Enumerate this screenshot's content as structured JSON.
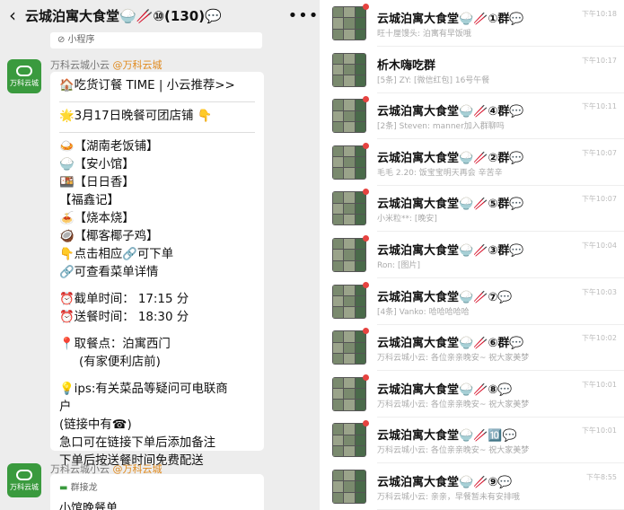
{
  "chat": {
    "back_icon": "back-arrow-icon",
    "title": "云城泊寓大食堂🍚🥢⑩(130)💬",
    "more": "•••",
    "mini_program": "⊘ 小程序",
    "sender1": "万科云城小云",
    "sender1_tag": "@万科云城",
    "avatar_label": "万科云城",
    "lines": [
      "🏠吃货订餐 TIME | 小云推荐>>",
      "🌟3月17日晚餐可团店铺 👇",
      "🍛【湖南老饭铺】",
      "🍚【安小馆】",
      "🍱【日日香】",
      "【福鑫记】",
      "🍝【烧本烧】",
      "🥥【椰客椰子鸡】",
      "👇点击相应🔗可下单",
      "🔗可查看菜单详情",
      "⏰截单时间：  17:15 分",
      "⏰送餐时间：  18:30 分",
      "📍取餐点：泊寓西门",
      "(有家便利店前)",
      "💡ips:有关菜品等疑问可电联商",
      "户",
      "(链接中有☎)",
      "急口可在链接下单后添加备注",
      "下单后按送餐时间免费配送"
    ],
    "sender2": "万科云城小云",
    "sender2_tag": "@万科云城",
    "jielong_label": "群接龙",
    "jielong_cut": "小馆晚餐单"
  },
  "groups": [
    {
      "name": "云城泊寓大食堂🍚🥢①群💬",
      "msg": "旺十厘馒头: 泊寓有早饭哦",
      "time": "下午10:18",
      "dot": true
    },
    {
      "name": "析木嗨吃群",
      "msg": "[5条] ZY: [微信红包] 16号午餐",
      "time": "下午10:17",
      "dot": false
    },
    {
      "name": "云城泊寓大食堂🍚🥢④群💬",
      "msg": "[2条] Steven: manner加入群聊吗",
      "time": "下午10:11",
      "dot": true
    },
    {
      "name": "云城泊寓大食堂🍚🥢②群💬",
      "msg": "毛毛 2.20: 饭宝宝明天再会 辛苦辛",
      "time": "下午10:07",
      "dot": true
    },
    {
      "name": "云城泊寓大食堂🍚🥢⑤群💬",
      "msg": "小米粒**: [晚安]",
      "time": "下午10:07",
      "dot": true
    },
    {
      "name": "云城泊寓大食堂🍚🥢③群💬",
      "msg": "Ron: [图片]",
      "time": "下午10:04",
      "dot": true
    },
    {
      "name": "云城泊寓大食堂🍚🥢⑦💬",
      "msg": "[4条] Vanko: 哈哈哈哈哈",
      "time": "下午10:03",
      "dot": true
    },
    {
      "name": "云城泊寓大食堂🍚🥢⑥群💬",
      "msg": "万科云城小云: 各位亲亲晚安~ 祝大家美梦",
      "time": "下午10:02",
      "dot": true
    },
    {
      "name": "云城泊寓大食堂🍚🥢⑧💬",
      "msg": "万科云城小云: 各位亲亲晚安~ 祝大家美梦",
      "time": "下午10:01",
      "dot": true
    },
    {
      "name": "云城泊寓大食堂🍚🥢🔟💬",
      "msg": "万科云城小云: 各位亲亲晚安~ 祝大家美梦",
      "time": "下午10:01",
      "dot": true
    },
    {
      "name": "云城泊寓大食堂🍚🥢⑨💬",
      "msg": "万科云城小云: 亲亲，早餐暂未有安排哦",
      "time": "下午8:55",
      "dot": false
    }
  ]
}
